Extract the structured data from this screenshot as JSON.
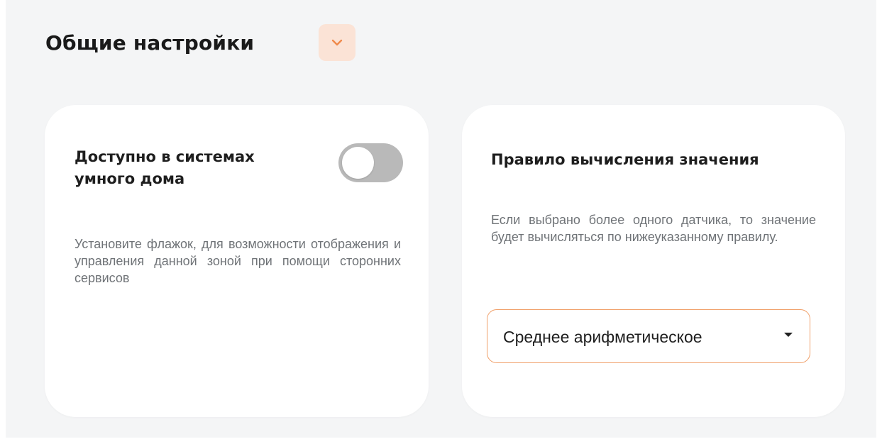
{
  "section": {
    "title": "Общие настройки",
    "collapse_icon": "chevron-down-icon",
    "accent_color": "#f08a4b",
    "accent_bg": "#fbe3d6"
  },
  "smart_home_card": {
    "title": "Доступно в системах умного дома",
    "toggle_on": false,
    "description": "Установите флажок, для возможности отображения и управления данной зоной при помощи сторонних сервисов"
  },
  "calc_rule_card": {
    "title": "Правило вычисления значения",
    "description": "Если выбрано более одного датчика, то значение будет вычисляться по нижеуказанному правилу.",
    "select": {
      "value": "Среднее арифметическое",
      "icon": "caret-down-icon"
    }
  }
}
